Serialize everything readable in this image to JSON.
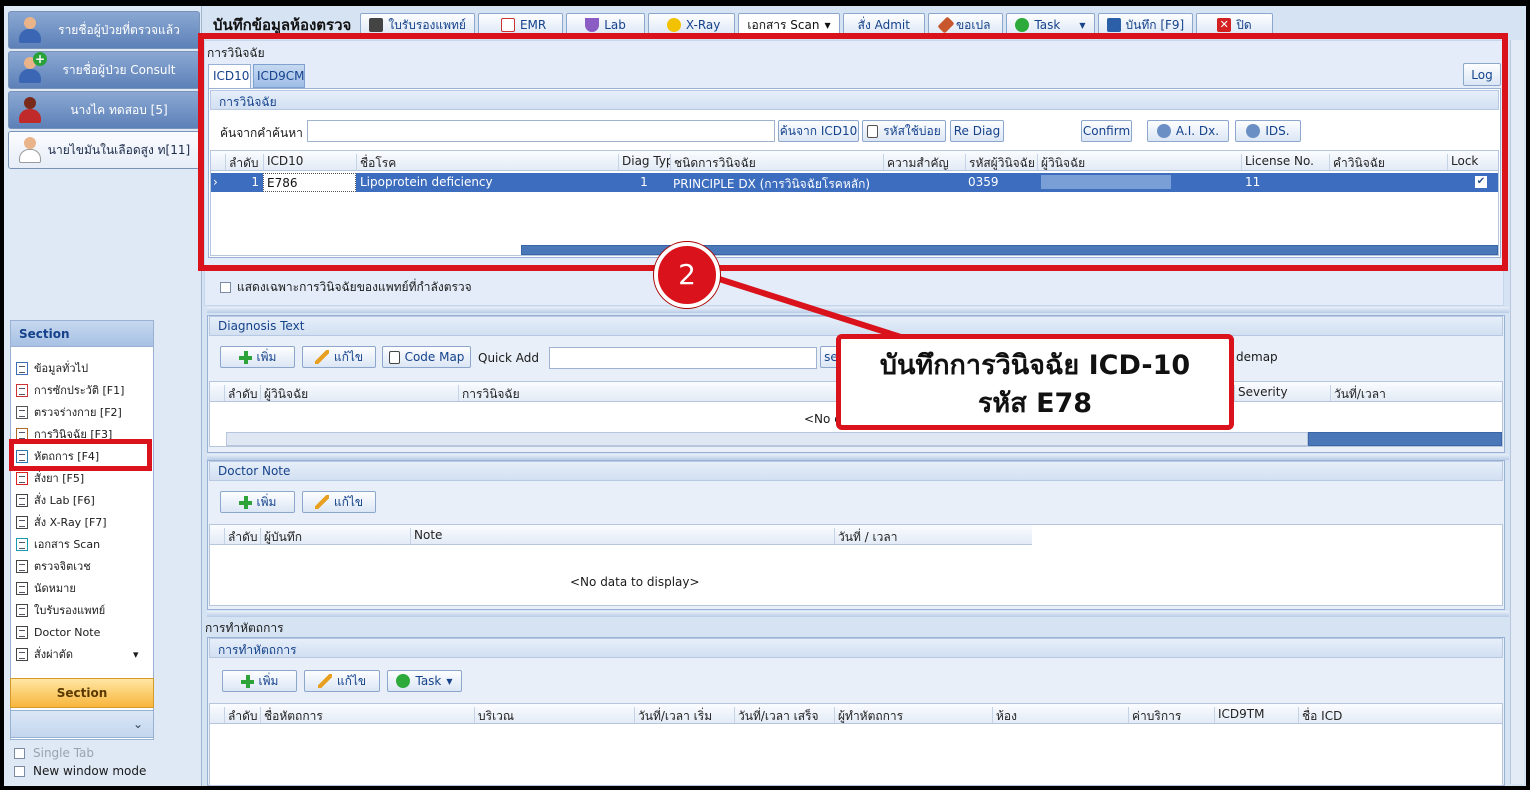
{
  "left_panel": {
    "patients": [
      {
        "label": "รายชื่อผู้ป่วยที่ตรวจแล้ว"
      },
      {
        "label": "รายชื่อผู้ป่วย Consult"
      },
      {
        "label": "นางไค ทดสอบ [5]"
      },
      {
        "label": "นายไขมันในเลือดสูง ท[11]"
      }
    ],
    "section_title": "Section",
    "section_items": [
      "ข้อมูลทั่วไป",
      "การซักประวัติ [F1]",
      "ตรวจร่างกาย [F2]",
      "การวินิจฉัย [F3]",
      "หัตถการ [F4]",
      "สั่งยา [F5]",
      "สั่ง Lab  [F6]",
      "สั่ง X-Ray  [F7]",
      "เอกสาร Scan",
      "ตรวจจิตเวช",
      "นัดหมาย",
      "ใบรับรองแพทย์",
      "Doctor Note",
      "สั่งผ่าตัด"
    ],
    "section_footer": "Section",
    "single_tab": "Single Tab",
    "new_window": "New window mode"
  },
  "toolbar": {
    "title": "บันทึกข้อมูลห้องตรวจ",
    "buttons": [
      "ใบรับรองแพทย์",
      "EMR",
      "Lab",
      "X-Ray",
      "เอกสาร Scan",
      "สั่ง Admit",
      "ขอเปล",
      "Task",
      "บันทึก [F9]",
      "ปิด"
    ]
  },
  "diagnosis": {
    "group_label": "การวินิจฉัย",
    "tabs": [
      "ICD10",
      "ICD9CM"
    ],
    "log_button": "Log",
    "inner_label": "การวินิจฉัย",
    "search_label": "ค้นจากคำค้นหา",
    "search_value": "",
    "buttons": {
      "search_icd10": "ค้นจาก ICD10",
      "frequent": "รหัสใช้บ่อย",
      "rediag": "Re Diag",
      "confirm": "Confirm",
      "ai_dx": "A.I. Dx.",
      "ids": "IDS."
    },
    "columns": [
      "ลำดับ",
      "ICD10",
      "ชื่อโรค",
      "Diag Typ",
      "ชนิดการวินิจฉัย",
      "ความสำคัญ",
      "รหัสผู้วินิจฉัย",
      "ผู้วินิจฉัย",
      "License No.",
      "คำวินิจฉัย",
      "Lock"
    ],
    "rows": [
      {
        "no": "1",
        "icd10": "E786",
        "name": "Lipoprotein deficiency",
        "diag_type": "1",
        "kind": "PRINCIPLE DX (การวินิจฉัยโรคหลัก)",
        "importance": "",
        "diag_code": "0359",
        "doctor": "",
        "license": "11",
        "note": "",
        "lock": true
      }
    ],
    "show_own_checkbox": "แสดงเฉพาะการวินิจฉัยของแพทย์ที่กำลังตรวจ"
  },
  "diagnosis_text": {
    "label": "Diagnosis Text",
    "add": "เพิ่ม",
    "edit": "แก้ไข",
    "code_map": "Code Map",
    "quick_add": "Quick Add",
    "quick_add_value": "",
    "truncated_btn": "se",
    "right_trunc": "demap",
    "columns": [
      "ลำดับ",
      "ผู้วินิจฉัย",
      "การวินิจฉัย",
      "Severity",
      "วันที่/เวลา"
    ],
    "empty": "<No d"
  },
  "doctor_note": {
    "label": "Doctor Note",
    "add": "เพิ่ม",
    "edit": "แก้ไข",
    "columns": [
      "ลำดับ",
      "ผู้บันทึก",
      "Note",
      "วันที่ / เวลา"
    ],
    "empty": "<No data to display>"
  },
  "procedure": {
    "outer_label": "การทำหัตถการ",
    "inner_label": "การทำหัตถการ",
    "add": "เพิ่ม",
    "edit": "แก้ไข",
    "task": "Task",
    "columns": [
      "ลำดับ",
      "ชื่อหัตถการ",
      "บริเวณ",
      "วันที่/เวลา เริ่ม",
      "วันที่/เวลา เสร็จ",
      "ผู้ทำหัตถการ",
      "ห้อง",
      "ค่าบริการ",
      "ICD9TM",
      "ชื่อ ICD"
    ]
  },
  "annotation": {
    "step": "2",
    "line1": "บันทึกการวินิจฉัย ICD-10",
    "line2": "รหัส E78",
    "color": "#d9121b"
  }
}
